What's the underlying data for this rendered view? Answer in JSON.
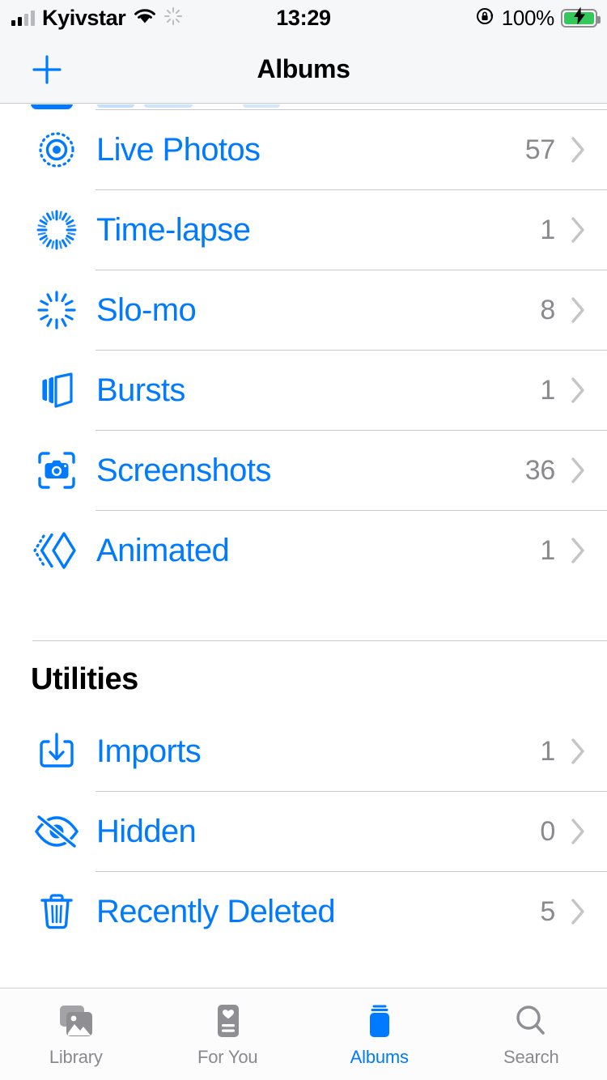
{
  "status_bar": {
    "carrier": "Kyivstar",
    "time": "13:29",
    "battery_percent": "100%",
    "icons": {
      "signal": "signal-bars-icon",
      "wifi": "wifi-icon",
      "activity": "activity-spinner-icon",
      "rotation_lock": "rotation-lock-icon",
      "battery": "battery-charging-icon"
    }
  },
  "nav_bar": {
    "title": "Albums",
    "add_button": "+"
  },
  "media_types": {
    "rows": [
      {
        "icon": "live-photos-icon",
        "label": "Live Photos",
        "count": "57"
      },
      {
        "icon": "time-lapse-icon",
        "label": "Time-lapse",
        "count": "1"
      },
      {
        "icon": "slo-mo-icon",
        "label": "Slo-mo",
        "count": "8"
      },
      {
        "icon": "bursts-icon",
        "label": "Bursts",
        "count": "1"
      },
      {
        "icon": "screenshots-icon",
        "label": "Screenshots",
        "count": "36"
      },
      {
        "icon": "animated-icon",
        "label": "Animated",
        "count": "1"
      }
    ]
  },
  "utilities": {
    "header": "Utilities",
    "rows": [
      {
        "icon": "imports-icon",
        "label": "Imports",
        "count": "1"
      },
      {
        "icon": "hidden-icon",
        "label": "Hidden",
        "count": "0"
      },
      {
        "icon": "recently-deleted-icon",
        "label": "Recently Deleted",
        "count": "5"
      }
    ]
  },
  "tab_bar": {
    "tabs": [
      {
        "icon": "library-icon",
        "label": "Library",
        "active": false
      },
      {
        "icon": "for-you-icon",
        "label": "For You",
        "active": false
      },
      {
        "icon": "albums-icon",
        "label": "Albums",
        "active": true
      },
      {
        "icon": "search-icon",
        "label": "Search",
        "active": false
      }
    ]
  },
  "colors": {
    "accent": "#007aff",
    "secondary_text": "#8a8a8e",
    "chevron": "#c5c5c7",
    "separator": "#c8c7cc",
    "bar_background": "#f6f7f9",
    "battery_green": "#34c759"
  }
}
